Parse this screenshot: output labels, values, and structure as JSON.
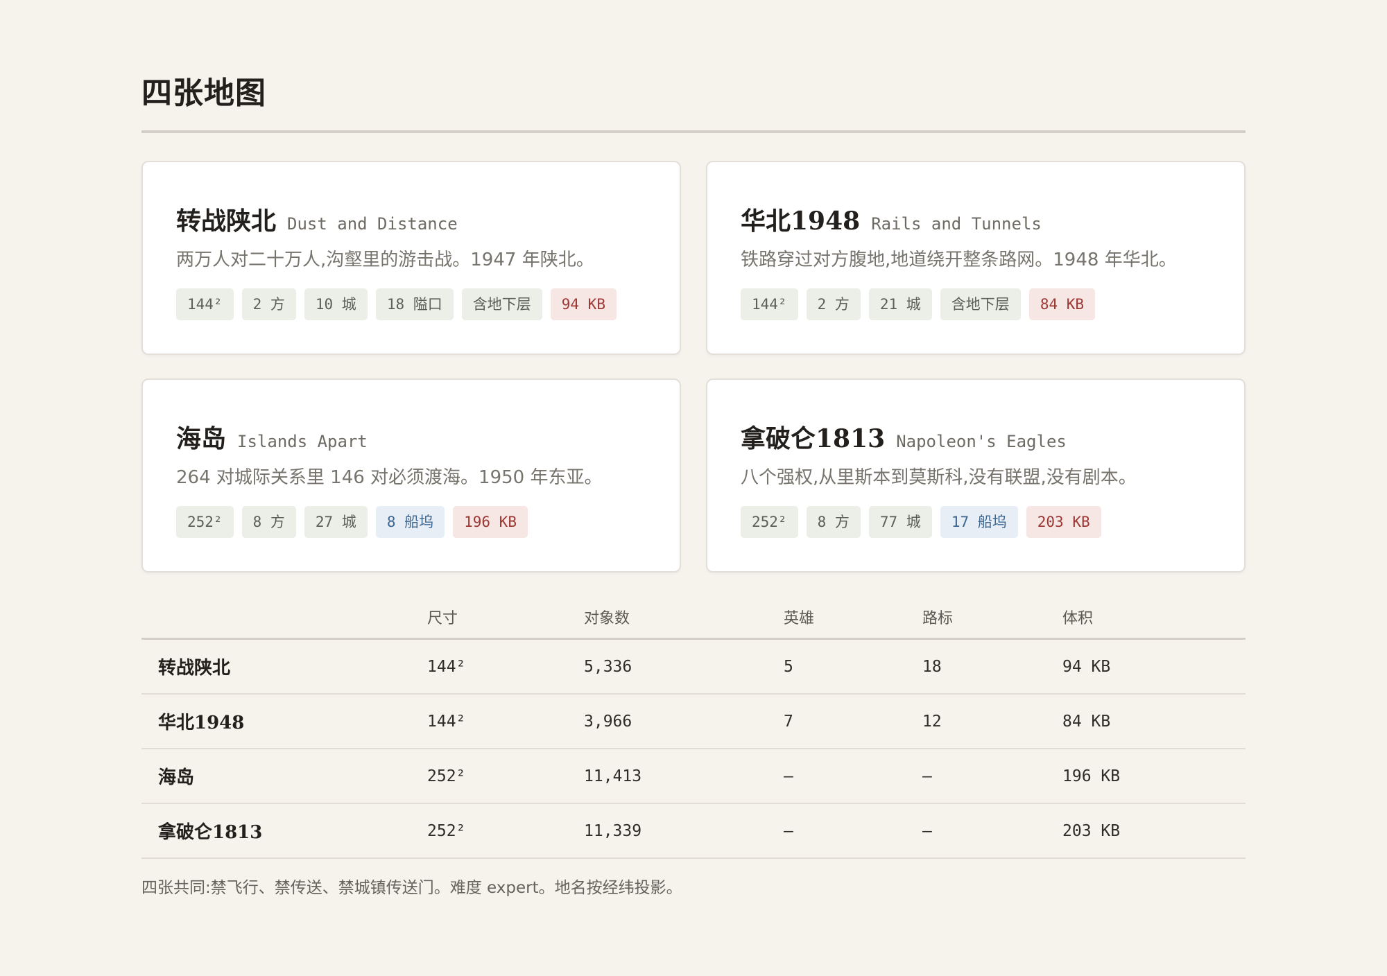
{
  "title": "四张地图",
  "cards": [
    {
      "title": "转战陕北",
      "subtitle": "Dust and Distance",
      "desc": "两万人对二十万人,沟壑里的游击战。1947 年陕北。",
      "tags": [
        "144²",
        "2 方",
        "10 城",
        "18 隘口",
        "含地下层",
        "94 KB"
      ]
    },
    {
      "title": "华北1948",
      "subtitle": "Rails and Tunnels",
      "desc": "铁路穿过对方腹地,地道绕开整条路网。1948 年华北。",
      "tags": [
        "144²",
        "2 方",
        "21 城",
        "含地下层",
        "84 KB"
      ]
    },
    {
      "title": "海岛",
      "subtitle": "Islands Apart",
      "desc": "264 对城际关系里 146 对必须渡海。1950 年东亚。",
      "tags": [
        "252²",
        "8 方",
        "27 城",
        "8 船坞",
        "196 KB"
      ]
    },
    {
      "title": "拿破仑1813",
      "subtitle": "Napoleon's Eagles",
      "desc": "八个强权,从里斯本到莫斯科,没有联盟,没有剧本。",
      "tags": [
        "252²",
        "8 方",
        "77 城",
        "17 船坞",
        "203 KB"
      ]
    }
  ],
  "table": {
    "headers": [
      "",
      "尺寸",
      "对象数",
      "英雄",
      "路标",
      "体积"
    ],
    "rows": [
      [
        "转战陕北",
        "144²",
        "5,336",
        "5",
        "18",
        "94 KB"
      ],
      [
        "华北1948",
        "144²",
        "3,966",
        "7",
        "12",
        "84 KB"
      ],
      [
        "海岛",
        "252²",
        "11,413",
        "—",
        "—",
        "196 KB"
      ],
      [
        "拿破仑1813",
        "252²",
        "11,339",
        "—",
        "—",
        "203 KB"
      ]
    ]
  },
  "footnote": "四张共同:禁飞行、禁传送、禁城镇传送门。难度 expert。地名按经纬投影。",
  "colors": {
    "background": "#f6f3ed",
    "tag_gray": "#eceee8",
    "tag_red": "#f6e6e4",
    "tag_blue": "#e7eef5"
  }
}
